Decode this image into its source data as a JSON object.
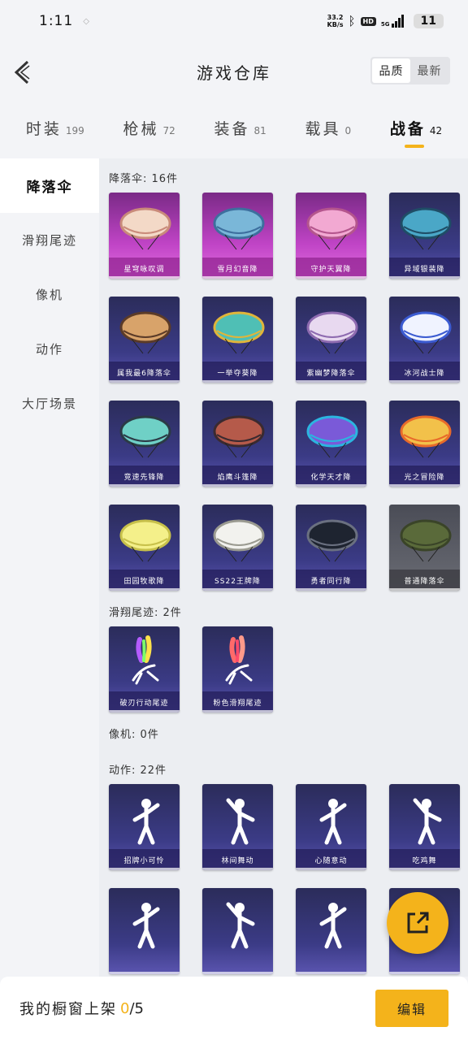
{
  "status_bar": {
    "time": "1:11",
    "speed_value": "33.2",
    "speed_unit": "KB/s",
    "hd": "HD",
    "network": "5G",
    "battery": "11"
  },
  "header": {
    "title": "游戏仓库",
    "sort": [
      {
        "label": "品质",
        "active": true
      },
      {
        "label": "最新",
        "active": false
      }
    ]
  },
  "tabs": [
    {
      "label": "时装",
      "count": "199",
      "active": false
    },
    {
      "label": "枪械",
      "count": "72",
      "active": false
    },
    {
      "label": "装备",
      "count": "81",
      "active": false
    },
    {
      "label": "载具",
      "count": "0",
      "active": false
    },
    {
      "label": "战备",
      "count": "42",
      "active": true
    }
  ],
  "sidebar": {
    "items": [
      {
        "label": "降落伞",
        "active": true
      },
      {
        "label": "滑翔尾迹",
        "active": false
      },
      {
        "label": "像机",
        "active": false
      },
      {
        "label": "动作",
        "active": false
      },
      {
        "label": "大厅场景",
        "active": false
      }
    ]
  },
  "sections": {
    "parachute": {
      "title": "降落伞: 16件",
      "items": [
        {
          "name": "星穹咏叹调",
          "style": "pink",
          "icon": "parachute-icon"
        },
        {
          "name": "雪月幻音降",
          "style": "pink",
          "icon": "parachute-icon"
        },
        {
          "name": "守护天翼降",
          "style": "pink",
          "icon": "parachute-icon"
        },
        {
          "name": "异域银装降",
          "style": "purple",
          "icon": "parachute-icon"
        },
        {
          "name": "属我最6降落伞",
          "style": "purple",
          "icon": "parachute-icon"
        },
        {
          "name": "一举夺葵降",
          "style": "purple",
          "icon": "parachute-icon"
        },
        {
          "name": "紫幽梦降落伞",
          "style": "purple",
          "icon": "parachute-icon"
        },
        {
          "name": "冰河战士降",
          "style": "purple",
          "icon": "parachute-icon"
        },
        {
          "name": "竞速先锋降",
          "style": "purple",
          "icon": "parachute-icon"
        },
        {
          "name": "焰鹰斗篷降",
          "style": "purple",
          "icon": "parachute-icon"
        },
        {
          "name": "化学天才降",
          "style": "purple",
          "icon": "parachute-icon"
        },
        {
          "name": "光之冒险降",
          "style": "purple",
          "icon": "parachute-icon"
        },
        {
          "name": "田园牧歌降",
          "style": "purple",
          "icon": "parachute-icon"
        },
        {
          "name": "SS22王牌降",
          "style": "purple",
          "icon": "parachute-icon"
        },
        {
          "name": "勇者同行降",
          "style": "purple",
          "icon": "parachute-icon"
        },
        {
          "name": "普通降落伞",
          "style": "grey",
          "icon": "parachute-icon"
        }
      ]
    },
    "trail": {
      "title": "滑翔尾迹: 2件",
      "items": [
        {
          "name": "破刃行动尾迹",
          "style": "purple",
          "icon": "trail-icon"
        },
        {
          "name": "粉色滑翔尾迹",
          "style": "purple",
          "icon": "trail-icon"
        }
      ]
    },
    "camera": {
      "title": "像机: 0件"
    },
    "emote": {
      "title": "动作: 22件",
      "items": [
        {
          "name": "招牌小可怜",
          "style": "purple",
          "icon": "emote-figure-icon"
        },
        {
          "name": "林间舞动",
          "style": "purple",
          "icon": "emote-figure-icon"
        },
        {
          "name": "心随意动",
          "style": "purple",
          "icon": "emote-figure-icon"
        },
        {
          "name": "吃鸡舞",
          "style": "purple",
          "icon": "emote-figure-icon"
        },
        {
          "name": "",
          "style": "purple",
          "icon": "emote-figure-icon"
        },
        {
          "name": "",
          "style": "purple",
          "icon": "emote-figure-icon"
        },
        {
          "name": "",
          "style": "purple",
          "icon": "emote-figure-icon"
        },
        {
          "name": "",
          "style": "purple",
          "icon": "emote-figure-icon"
        }
      ]
    }
  },
  "bottom": {
    "shelf_label": "我的橱窗上架",
    "shelf_used": "0",
    "shelf_total": "/5",
    "edit_label": "编辑"
  },
  "colors": {
    "accent": "#f4b31b",
    "card_purple": "#3b3b86",
    "card_pink": "#c044c6",
    "card_grey": "#6a6c74"
  }
}
